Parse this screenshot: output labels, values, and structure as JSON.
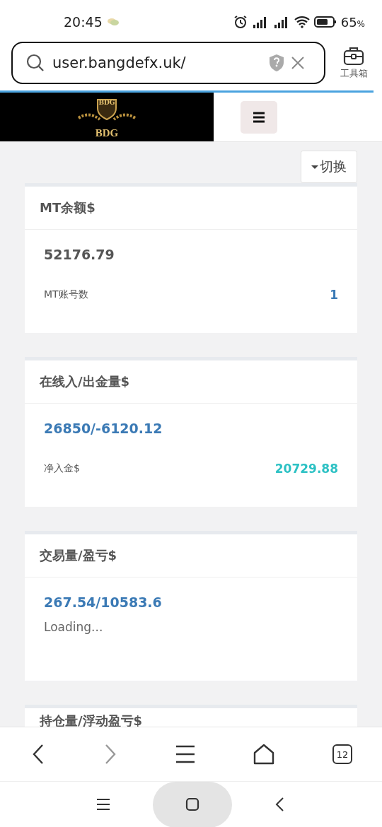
{
  "status_bar": {
    "time": "20:45",
    "battery": "65",
    "battery_unit": "%"
  },
  "browser": {
    "url": "user.bangdefx.uk/",
    "toolbox_label": "工具箱",
    "tab_count": "12"
  },
  "site_header": {
    "logo_badge": "BDG",
    "logo_text": "BDG"
  },
  "switch_button": {
    "label": "切换"
  },
  "cards": [
    {
      "title": "MT余额$",
      "value": {
        "text": "52176.79",
        "kind": "muted"
      },
      "row": {
        "label": "MT账号数",
        "value": "1",
        "kind": "link"
      }
    },
    {
      "title": "在线入/出金量$",
      "value": {
        "text": "26850/-6120.12",
        "kind": "link"
      },
      "row": {
        "label": "净入金$",
        "value": "20729.88",
        "kind": "positive"
      }
    },
    {
      "title": "交易量/盈亏$",
      "value": {
        "text": "267.54/10583.6",
        "kind": "link"
      },
      "note": "Loading..."
    },
    {
      "title": "持仓量/浮动盈亏$"
    }
  ]
}
